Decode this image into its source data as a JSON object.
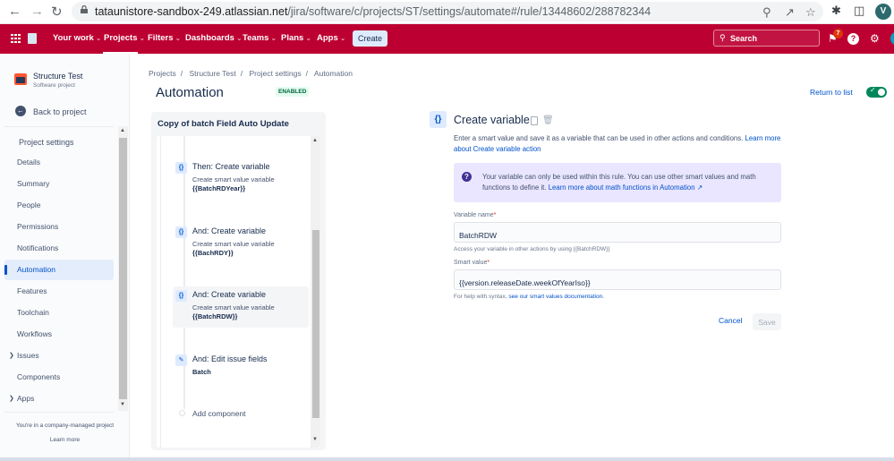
{
  "browser": {
    "url_host": "tataunistore-sandbox-249.atlassian.net",
    "url_path": "/jira/software/c/projects/ST/settings/automate#/rule/13448602/288782344",
    "profile_initial": "V"
  },
  "topnav": {
    "items": [
      {
        "label": "Your work"
      },
      {
        "label": "Projects"
      },
      {
        "label": "Filters"
      },
      {
        "label": "Dashboards"
      },
      {
        "label": "Teams"
      },
      {
        "label": "Plans"
      },
      {
        "label": "Apps"
      }
    ],
    "create_label": "Create",
    "search_placeholder": "Search",
    "notification_count": "7",
    "brand_color": "#bd0032"
  },
  "sidebar": {
    "project_name": "Structure Test",
    "project_type": "Software project",
    "back_label": "Back to project",
    "heading": "Project settings",
    "items": [
      {
        "label": "Details"
      },
      {
        "label": "Summary"
      },
      {
        "label": "People"
      },
      {
        "label": "Permissions"
      },
      {
        "label": "Notifications"
      },
      {
        "label": "Automation",
        "active": true
      },
      {
        "label": "Features"
      },
      {
        "label": "Toolchain"
      },
      {
        "label": "Workflows"
      },
      {
        "label": "Issues",
        "expandable": true
      },
      {
        "label": "Components"
      },
      {
        "label": "Apps",
        "expandable": true
      }
    ],
    "footer_text": "You're in a company-managed project",
    "footer_link": "Learn more"
  },
  "main": {
    "breadcrumb": [
      "Projects",
      "Structure Test",
      "Project settings",
      "Automation"
    ],
    "title": "Automation",
    "status_badge": "ENABLED",
    "return_link": "Return to list",
    "rule_enabled": true
  },
  "rule": {
    "name": "Copy of batch Field Auto Update",
    "steps": [
      {
        "title": "Then: Create variable",
        "desc": "Create smart value variable",
        "value": "{{BatchRDYear}}",
        "icon": "braces-icon"
      },
      {
        "title": "And: Create variable",
        "desc": "Create smart value variable",
        "value": "{{BachRDY}}",
        "icon": "braces-icon"
      },
      {
        "title": "And: Create variable",
        "desc": "Create smart value variable",
        "value": "{{BatchRDW}}",
        "icon": "braces-icon",
        "selected": true
      },
      {
        "title": "And: Edit issue fields",
        "desc": "",
        "value": "Batch",
        "icon": "pencil-icon"
      }
    ],
    "add_component_label": "Add component"
  },
  "detail": {
    "icon_glyph": "{}",
    "title": "Create variable",
    "description": "Enter a smart value and save it as a variable that can be used in other actions and conditions.",
    "description_link": "Learn more about Create variable action",
    "info_text": "Your variable can only be used within this rule. You can use other smart values and math functions to define it.",
    "info_link": "Learn more about math functions in Automation ↗",
    "variable_name_label": "Variable name",
    "variable_name_value": "BatchRDW",
    "variable_name_help": "Access your variable in other actions by using {{BatchRDW}}",
    "smart_value_label": "Smart value",
    "smart_value_value": "{{version.releaseDate.weekOfYearIso}}",
    "smart_value_help": "For help with syntax,",
    "smart_value_help_link": "see our smart values documentation.",
    "cancel_label": "Cancel",
    "save_label": "Save"
  }
}
